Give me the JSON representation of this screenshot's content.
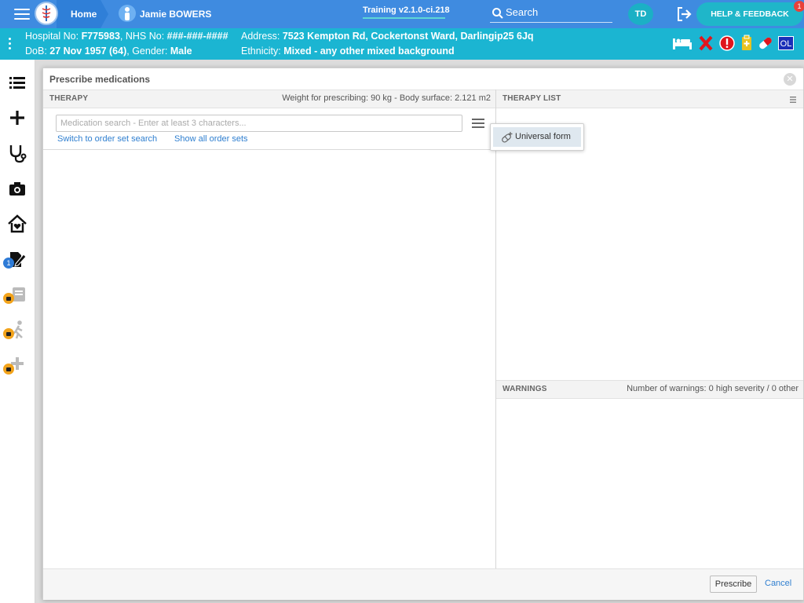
{
  "topbar": {
    "home_label": "Home",
    "patient_name": "Jamie BOWERS",
    "build": "Training v2.1.0-ci.218",
    "search_label": "Search",
    "avatar_initials": "TD",
    "help_label": "HELP & FEEDBACK",
    "help_badge": "1",
    "colors": {
      "bar": "#3f8be0",
      "accent": "#1fb6c9"
    }
  },
  "banner": {
    "hospital_label": "Hospital No: ",
    "hospital_value": "F775983",
    "nhs_label": ", NHS No: ",
    "nhs_value": "###-###-####",
    "dob_label": "DoB: ",
    "dob_value": "27 Nov 1957 (64)",
    "gender_label": ", Gender: ",
    "gender_value": "Male",
    "address_label": "Address: ",
    "address_value": "7523 Kempton Rd, Cockertonst Ward, Darlingip25 6Jq",
    "ethnicity_label": "Ethnicity: ",
    "ethnicity_value": "Mixed - any other mixed background",
    "ol_label": "OL",
    "color": "#1bb5d2"
  },
  "leftnav": {
    "items": [
      {
        "name": "list-icon"
      },
      {
        "name": "plus-icon"
      },
      {
        "name": "stethoscope-icon"
      },
      {
        "name": "camera-icon"
      },
      {
        "name": "home-heart-icon"
      },
      {
        "name": "edit-document-icon",
        "badge": "1"
      },
      {
        "name": "clipboard-icon",
        "locked": true
      },
      {
        "name": "walking-person-icon",
        "locked": true
      },
      {
        "name": "add-cross-icon",
        "locked": true
      }
    ]
  },
  "dialog": {
    "title": "Prescribe medications",
    "therapy_header": "THERAPY",
    "weight_info": "Weight for prescribing: 90 kg - Body surface: 2.121 m2",
    "therapy_list_header": "THERAPY LIST",
    "search_placeholder": "Medication search - Enter at least 3 characters...",
    "switch_link": "Switch to order set search",
    "show_all_link": "Show all order sets",
    "popover_item": "Universal form",
    "warnings_header": "WARNINGS",
    "warnings_info": "Number of warnings: 0 high severity / 0 other",
    "prescribe_button": "Prescribe",
    "cancel_button": "Cancel"
  }
}
